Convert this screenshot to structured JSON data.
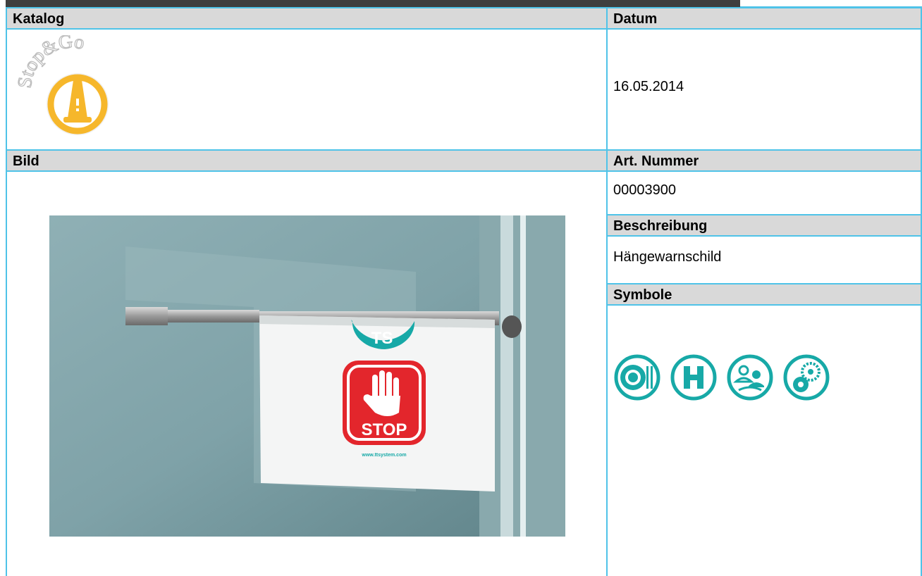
{
  "headers": {
    "katalog": "Katalog",
    "datum": "Datum",
    "bild": "Bild",
    "art_nummer": "Art. Nummer",
    "beschreibung": "Beschreibung",
    "symbole": "Symbole"
  },
  "values": {
    "datum": "16.05.2014",
    "art_nummer": "00003900",
    "beschreibung": "Hängewarnschild"
  },
  "logo": {
    "text": "Stop&Go",
    "icon": "traffic-cone-icon"
  },
  "product_image": {
    "sign_brand": "TS",
    "sign_text": "STOP",
    "sign_url": "www.ttsystem.com"
  },
  "symbols": [
    {
      "name": "plate-cutlery-icon"
    },
    {
      "name": "hospital-h-icon"
    },
    {
      "name": "people-group-icon"
    },
    {
      "name": "gear-icon"
    }
  ],
  "colors": {
    "border": "#4fc3e8",
    "header_bg": "#d9d9d9",
    "teal": "#17a9a7",
    "stop_red": "#e3262c",
    "logo_yellow": "#f6b72b"
  }
}
